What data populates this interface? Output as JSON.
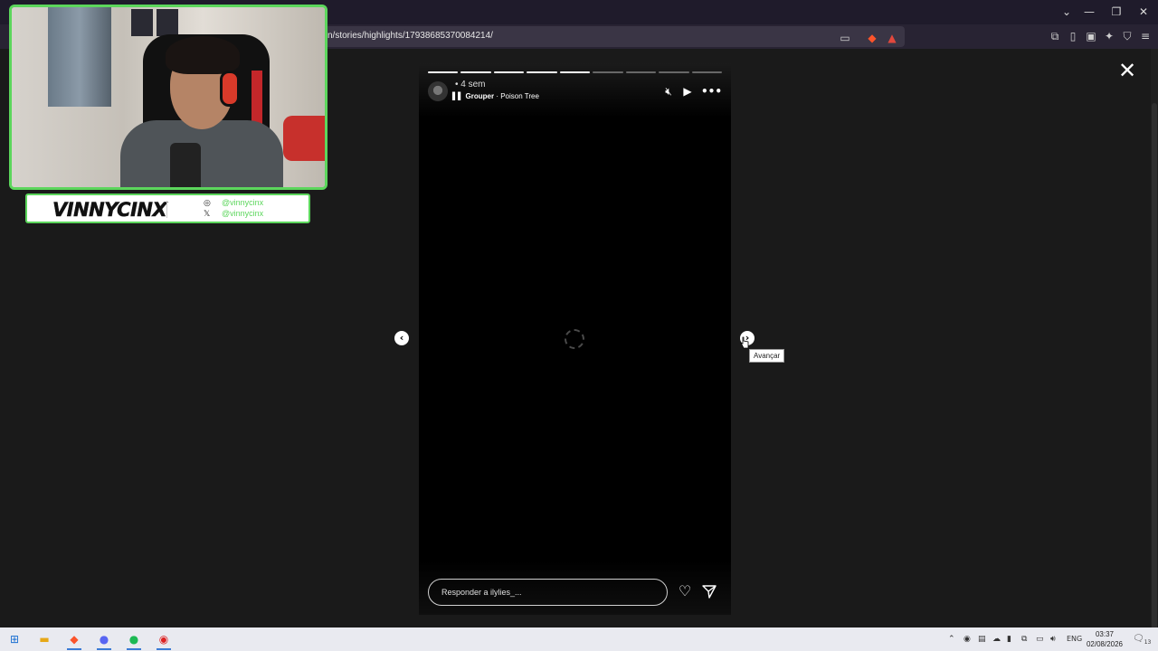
{
  "browser": {
    "url": "n/stories/highlights/17938685370084214/"
  },
  "story": {
    "time_ago": "4 sem",
    "music": {
      "artist": "Grouper",
      "separator": " · ",
      "track": "Poison Tree"
    },
    "progress": {
      "total_segments": 9,
      "completed_segments": 5
    },
    "reply_placeholder": "Responder a ilylies_..."
  },
  "navigation": {
    "next_tooltip": "Avançar"
  },
  "overlay": {
    "streamer_name": "VINNYCINX",
    "instagram": "@vinnycinx",
    "x": "@vinnycinx",
    "accent_color": "#5cd65c"
  },
  "taskbar": {
    "language": "ENG",
    "time": "03:37",
    "date": "02/08/2026",
    "notification_count": "13"
  }
}
